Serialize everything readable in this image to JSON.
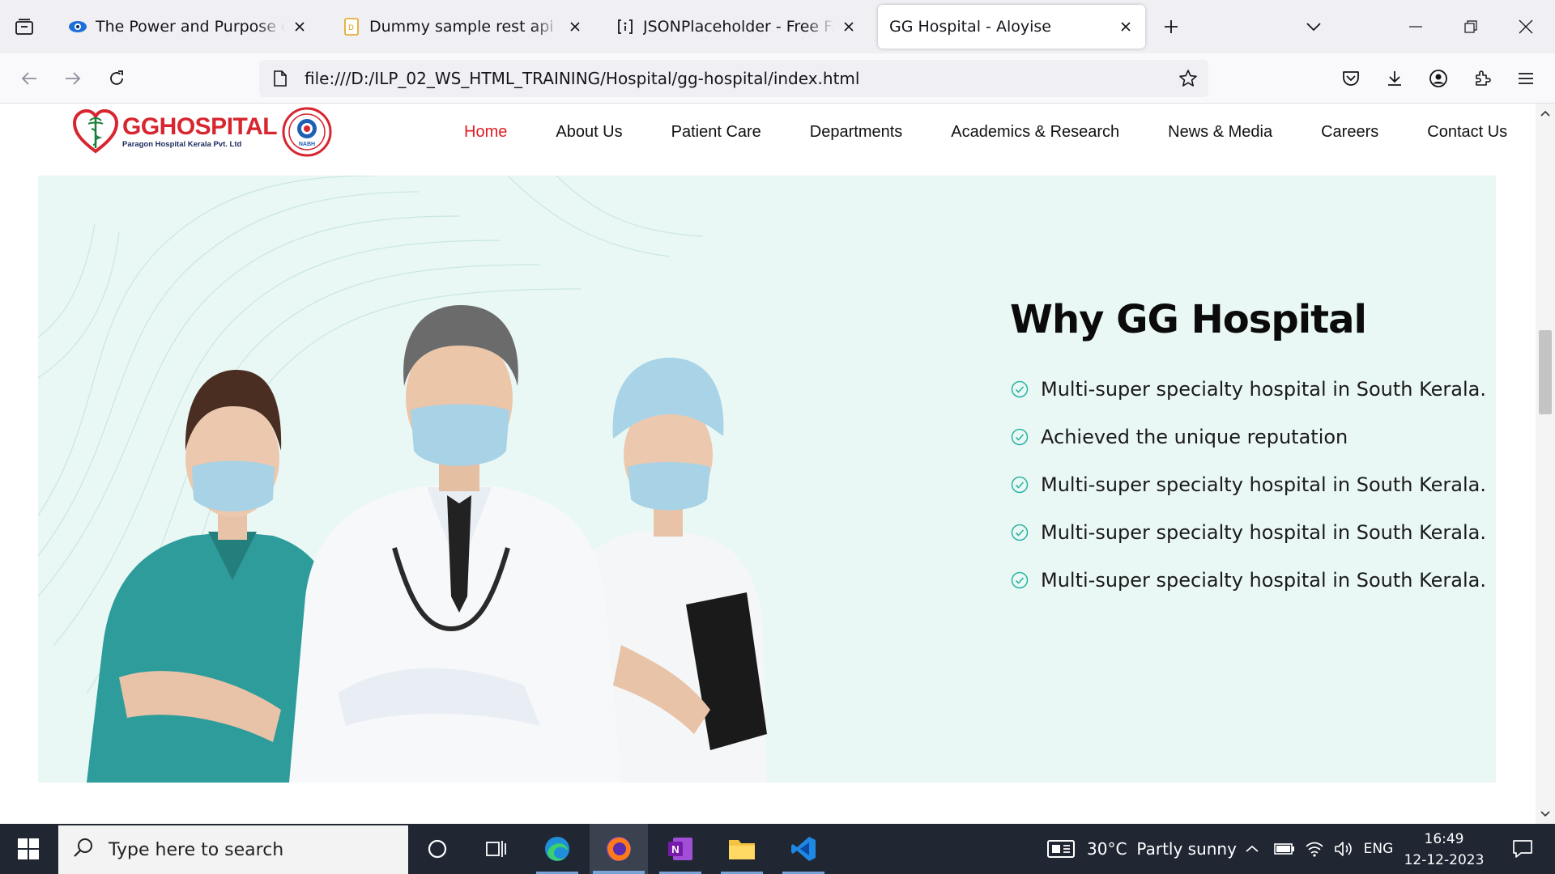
{
  "browser": {
    "tabs": [
      {
        "title": "The Power and Purpose of Team",
        "active": false,
        "favicon": "eye-logo-icon"
      },
      {
        "title": "Dummy sample rest api - dummy",
        "active": false,
        "favicon": "document-favicon-icon"
      },
      {
        "title": "JSONPlaceholder - Free Fake REST",
        "active": false,
        "favicon": "brackets-favicon-icon"
      },
      {
        "title": "GG Hospital - Aloyise",
        "active": true,
        "favicon": "none"
      }
    ],
    "url": "file:///D:/ILP_02_WS_HTML_TRAINING/Hospital/gg-hospital/index.html"
  },
  "site": {
    "logo": {
      "name": "GGHOSPITAL",
      "subtitle": "Paragon Hospital Kerala Pvt. Ltd",
      "badge_text": "NABH"
    },
    "nav": [
      {
        "label": "Home",
        "active": true
      },
      {
        "label": "About Us",
        "active": false
      },
      {
        "label": "Patient Care",
        "active": false
      },
      {
        "label": "Departments",
        "active": false
      },
      {
        "label": "Academics & Research",
        "active": false
      },
      {
        "label": "News & Media",
        "active": false
      },
      {
        "label": "Careers",
        "active": false
      },
      {
        "label": "Contact Us",
        "active": false
      }
    ],
    "why": {
      "title": "Why GG Hospital",
      "items": [
        "Multi-super specialty hospital in South Kerala.",
        "Achieved the unique reputation",
        "Multi-super specialty hospital in South Kerala.",
        "Multi-super specialty hospital in South Kerala.",
        "Multi-super specialty hospital in South Kerala."
      ]
    },
    "colors": {
      "accent": "#e11b22",
      "hero_bg": "#eaf8f5",
      "check": "#2bb3a3"
    }
  },
  "taskbar": {
    "search_placeholder": "Type here to search",
    "weather": {
      "temp": "30°C",
      "condition": "Partly sunny"
    },
    "language": "ENG",
    "time": "16:49",
    "date": "12-12-2023"
  }
}
